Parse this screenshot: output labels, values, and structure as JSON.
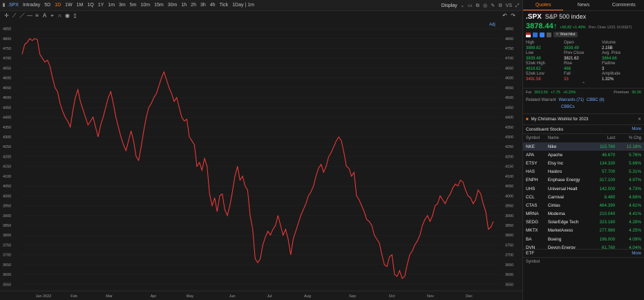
{
  "toolbar": {
    "ticker": ".SPX",
    "timeframes": [
      "Intraday",
      "5D",
      "1D",
      "1W",
      "1M",
      "1Q",
      "1Y",
      "1m",
      "3m",
      "5m",
      "10m",
      "15m",
      "30m",
      "1h",
      "2h",
      "3h",
      "4h",
      "Tick",
      "1Day | 1m"
    ],
    "active_timeframe": "1D",
    "display_label": "Display",
    "vs_label": "VS",
    "adj_label": "Adj"
  },
  "chart_data": {
    "type": "line",
    "x_labels": [
      "Jan 2022",
      "Feb",
      "Mar",
      "Apr",
      "May",
      "Jun",
      "Jul",
      "Aug",
      "Sep",
      "Oct",
      "Nov",
      "Dec"
    ],
    "y_ticks": [
      4850,
      4800,
      4750,
      4700,
      4650,
      4600,
      4550,
      4500,
      4450,
      4400,
      4350,
      4300,
      4250,
      4200,
      4150,
      4100,
      4050,
      4000,
      3950,
      3900,
      3850,
      3800,
      3750,
      3700,
      3650,
      3600,
      3550
    ],
    "ylim": [
      3530,
      4880
    ],
    "line_color": "#ff3b3b",
    "values": [
      4720,
      4770,
      4780,
      4800,
      4790,
      4800,
      4795,
      4720,
      4700,
      4680,
      4690,
      4660,
      4600,
      4550,
      4530,
      4470,
      4430,
      4400,
      4380,
      4350,
      4430,
      4500,
      4540,
      4480,
      4440,
      4400,
      4360,
      4380,
      4400,
      4350,
      4300,
      4360,
      4400,
      4450,
      4500,
      4530,
      4470,
      4400,
      4350,
      4300,
      4260,
      4230,
      4280,
      4330,
      4280,
      4200,
      4180,
      4250,
      4330,
      4400,
      4450,
      4470,
      4500,
      4520,
      4560,
      4600,
      4630,
      4590,
      4550,
      4520,
      4480,
      4500,
      4450,
      4400,
      4380,
      4390,
      4300,
      4280,
      4260,
      4150,
      4170,
      4130,
      4190,
      4150,
      4010,
      3950,
      3990,
      3920,
      4000,
      4010,
      3930,
      3900,
      3950,
      4020,
      4100,
      4150,
      4080,
      4100,
      4050,
      4030,
      3900,
      3830,
      3680,
      3660,
      3680,
      3750,
      3790,
      3820,
      3800,
      3830,
      3850,
      3900,
      3850,
      3800,
      3830,
      3780,
      3700,
      3780,
      3820,
      3860,
      3900,
      3930,
      3960,
      4000,
      4020,
      4050,
      4100,
      4140,
      4160,
      4120,
      4150,
      4200,
      4220,
      4250,
      4280,
      4300,
      4280,
      4220,
      4150,
      4140,
      4100,
      4120,
      4000,
      3980,
      3950,
      3920,
      3880,
      3870,
      3850,
      3800,
      3780,
      3760,
      3700,
      3650,
      3640,
      3690,
      3700,
      3600,
      3590,
      3620,
      3580,
      3590,
      3650,
      3700,
      3720,
      3750,
      3770,
      3800,
      3850,
      3880,
      3900,
      3870,
      3900,
      3950,
      3960,
      4000,
      3980,
      3960,
      3990,
      4010,
      4040,
      4060,
      4050,
      4080,
      4070,
      4030,
      4000,
      3990,
      3960,
      3980,
      4030,
      4010,
      3960,
      3920,
      3830,
      3840,
      3870
    ]
  },
  "panel": {
    "tabs": [
      "Quotes",
      "News",
      "Comments"
    ],
    "code": ".SPX",
    "name": "S&P 500 index",
    "price": "3878.44",
    "arrow": "↑",
    "change": "+56.82 +1.49%",
    "prev_close_note": "Prev. Close 12/21 16:00(ET)",
    "watchlist": "Watchlist",
    "stats": [
      [
        {
          "l": "High"
        },
        {
          "l": "Open"
        },
        {
          "l": "Volume"
        }
      ],
      [
        {
          "v": "3889.82",
          "c": "green"
        },
        {
          "v": "3839.49",
          "c": "green"
        },
        {
          "v": "2.15B",
          "c": ""
        }
      ],
      [
        {
          "l": "Low"
        },
        {
          "l": "Prev Close"
        },
        {
          "l": "Avg. Price"
        }
      ],
      [
        {
          "v": "3839.49",
          "c": "green"
        },
        {
          "v": "3821.62",
          "c": ""
        },
        {
          "v": "3864.66",
          "c": "green"
        }
      ],
      [
        {
          "l": "52wk High"
        },
        {
          "l": "Rise"
        },
        {
          "l": "Flatline"
        }
      ],
      [
        {
          "v": "4818.62",
          "c": "green"
        },
        {
          "v": "468",
          "c": "green"
        },
        {
          "v": "3",
          "c": ""
        }
      ],
      [
        {
          "l": "52wk Low"
        },
        {
          "l": "Fall"
        },
        {
          "l": "Amplitude"
        }
      ],
      [
        {
          "v": "3491.58",
          "c": "red"
        },
        {
          "v": "33",
          "c": "red"
        },
        {
          "v": "1.32%",
          "c": ""
        }
      ]
    ],
    "fut": {
      "label": "Fut",
      "price": "3913.50",
      "chg": "+7.75",
      "pct": "+0.20%",
      "premium_label": "Premium",
      "premium": "35.00"
    },
    "warrant": {
      "label": "Related Warrant",
      "warrants": "Warrants (71)",
      "cbbc": "CBBC (8)",
      "cbbcs": "CBBCs"
    },
    "wish": "My Christmas Wishlist for 2023",
    "constituents": {
      "title": "Constituent Stocks",
      "more": "More",
      "headers": [
        "Symbol",
        "Name",
        "Last",
        "% Chg"
      ],
      "rows": [
        [
          "NKE",
          "Nike",
          "115.760",
          "12.18%"
        ],
        [
          "APA",
          "Apache",
          "46.670",
          "5.76%"
        ],
        [
          "ETSY",
          "Etsy Inc",
          "134.330",
          "5.69%"
        ],
        [
          "HAS",
          "Hasbro",
          "57.700",
          "5.31%"
        ],
        [
          "ENPH",
          "Enphase Energy",
          "317.100",
          "4.97%"
        ],
        [
          "UHS",
          "Universal Healt",
          "142.000",
          "4.73%"
        ],
        [
          "CCL",
          "Carnival",
          "8.480",
          "4.69%"
        ],
        [
          "CTAS",
          "Cintas",
          "464.390",
          "4.61%"
        ],
        [
          "MRNA",
          "Moderna",
          "210.040",
          "4.41%"
        ],
        [
          "SEDG",
          "SolarEdge Tech",
          "323.160",
          "4.28%"
        ],
        [
          "MKTX",
          "MarketAxess",
          "277.980",
          "4.25%"
        ],
        [
          "BA",
          "Boeing",
          "196.000",
          "4.09%"
        ],
        [
          "DVN",
          "Devon Energy",
          "61.760",
          "4.04%"
        ]
      ]
    },
    "etf": {
      "title": "ETF",
      "more": "More",
      "header": "Symbol"
    }
  }
}
